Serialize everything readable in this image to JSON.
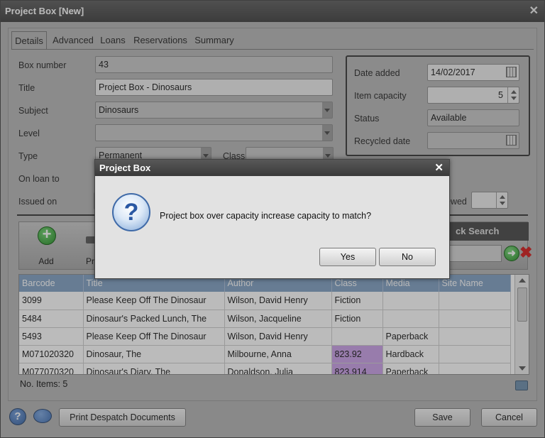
{
  "window": {
    "title": "Project Box [New]"
  },
  "tabs": [
    "Details",
    "Advanced",
    "Loans",
    "Reservations",
    "Summary"
  ],
  "form": {
    "box_number_label": "Box number",
    "box_number": "43",
    "title_label": "Title",
    "title": "Project Box - Dinosaurs",
    "subject_label": "Subject",
    "subject": "Dinosaurs",
    "level_label": "Level",
    "level": "",
    "type_label": "Type",
    "type": "Permanent",
    "class_label": "Class",
    "class": "",
    "on_loan_to_label": "On loan to",
    "issued_on_label": "Issued on",
    "renewed_label": "ewed",
    "date_added_label": "Date added",
    "date_added": "14/02/2017",
    "item_capacity_label": "Item capacity",
    "item_capacity": "5",
    "status_label": "Status",
    "status": "Available",
    "recycled_date_label": "Recycled date",
    "recycled_date": ""
  },
  "toolbar": {
    "add_label": "Add",
    "print_label": "Pri",
    "quick_search_label": "ck Search"
  },
  "grid": {
    "columns": [
      "Barcode",
      "Title",
      "Author",
      "Class",
      "Media",
      "Site Name"
    ],
    "rows": [
      [
        "3099",
        "Please Keep Off The Dinosaur",
        "Wilson, David Henry",
        "Fiction",
        "",
        ""
      ],
      [
        "5484",
        "Dinosaur's Packed Lunch, The",
        "Wilson, Jacqueline",
        "Fiction",
        "",
        ""
      ],
      [
        "5493",
        "Please Keep Off The Dinosaur",
        "Wilson, David Henry",
        "",
        "Paperback",
        ""
      ],
      [
        "M071020320",
        "Dinosaur, The",
        "Milbourne, Anna",
        "823.92",
        "Hardback",
        ""
      ],
      [
        "M077070320",
        "Dinosaur's Diary, The",
        "Donaldson, Julia",
        "823.914",
        "Paperback",
        ""
      ]
    ],
    "highlight_color": "#c99fe8"
  },
  "footer": {
    "count": "No. Items: 5",
    "print_despatch": "Print Despatch Documents",
    "save": "Save",
    "cancel": "Cancel"
  },
  "dialog": {
    "title": "Project Box",
    "message": "Project box over capacity increase capacity to match?",
    "yes": "Yes",
    "no": "No",
    "icon": "question-icon"
  }
}
